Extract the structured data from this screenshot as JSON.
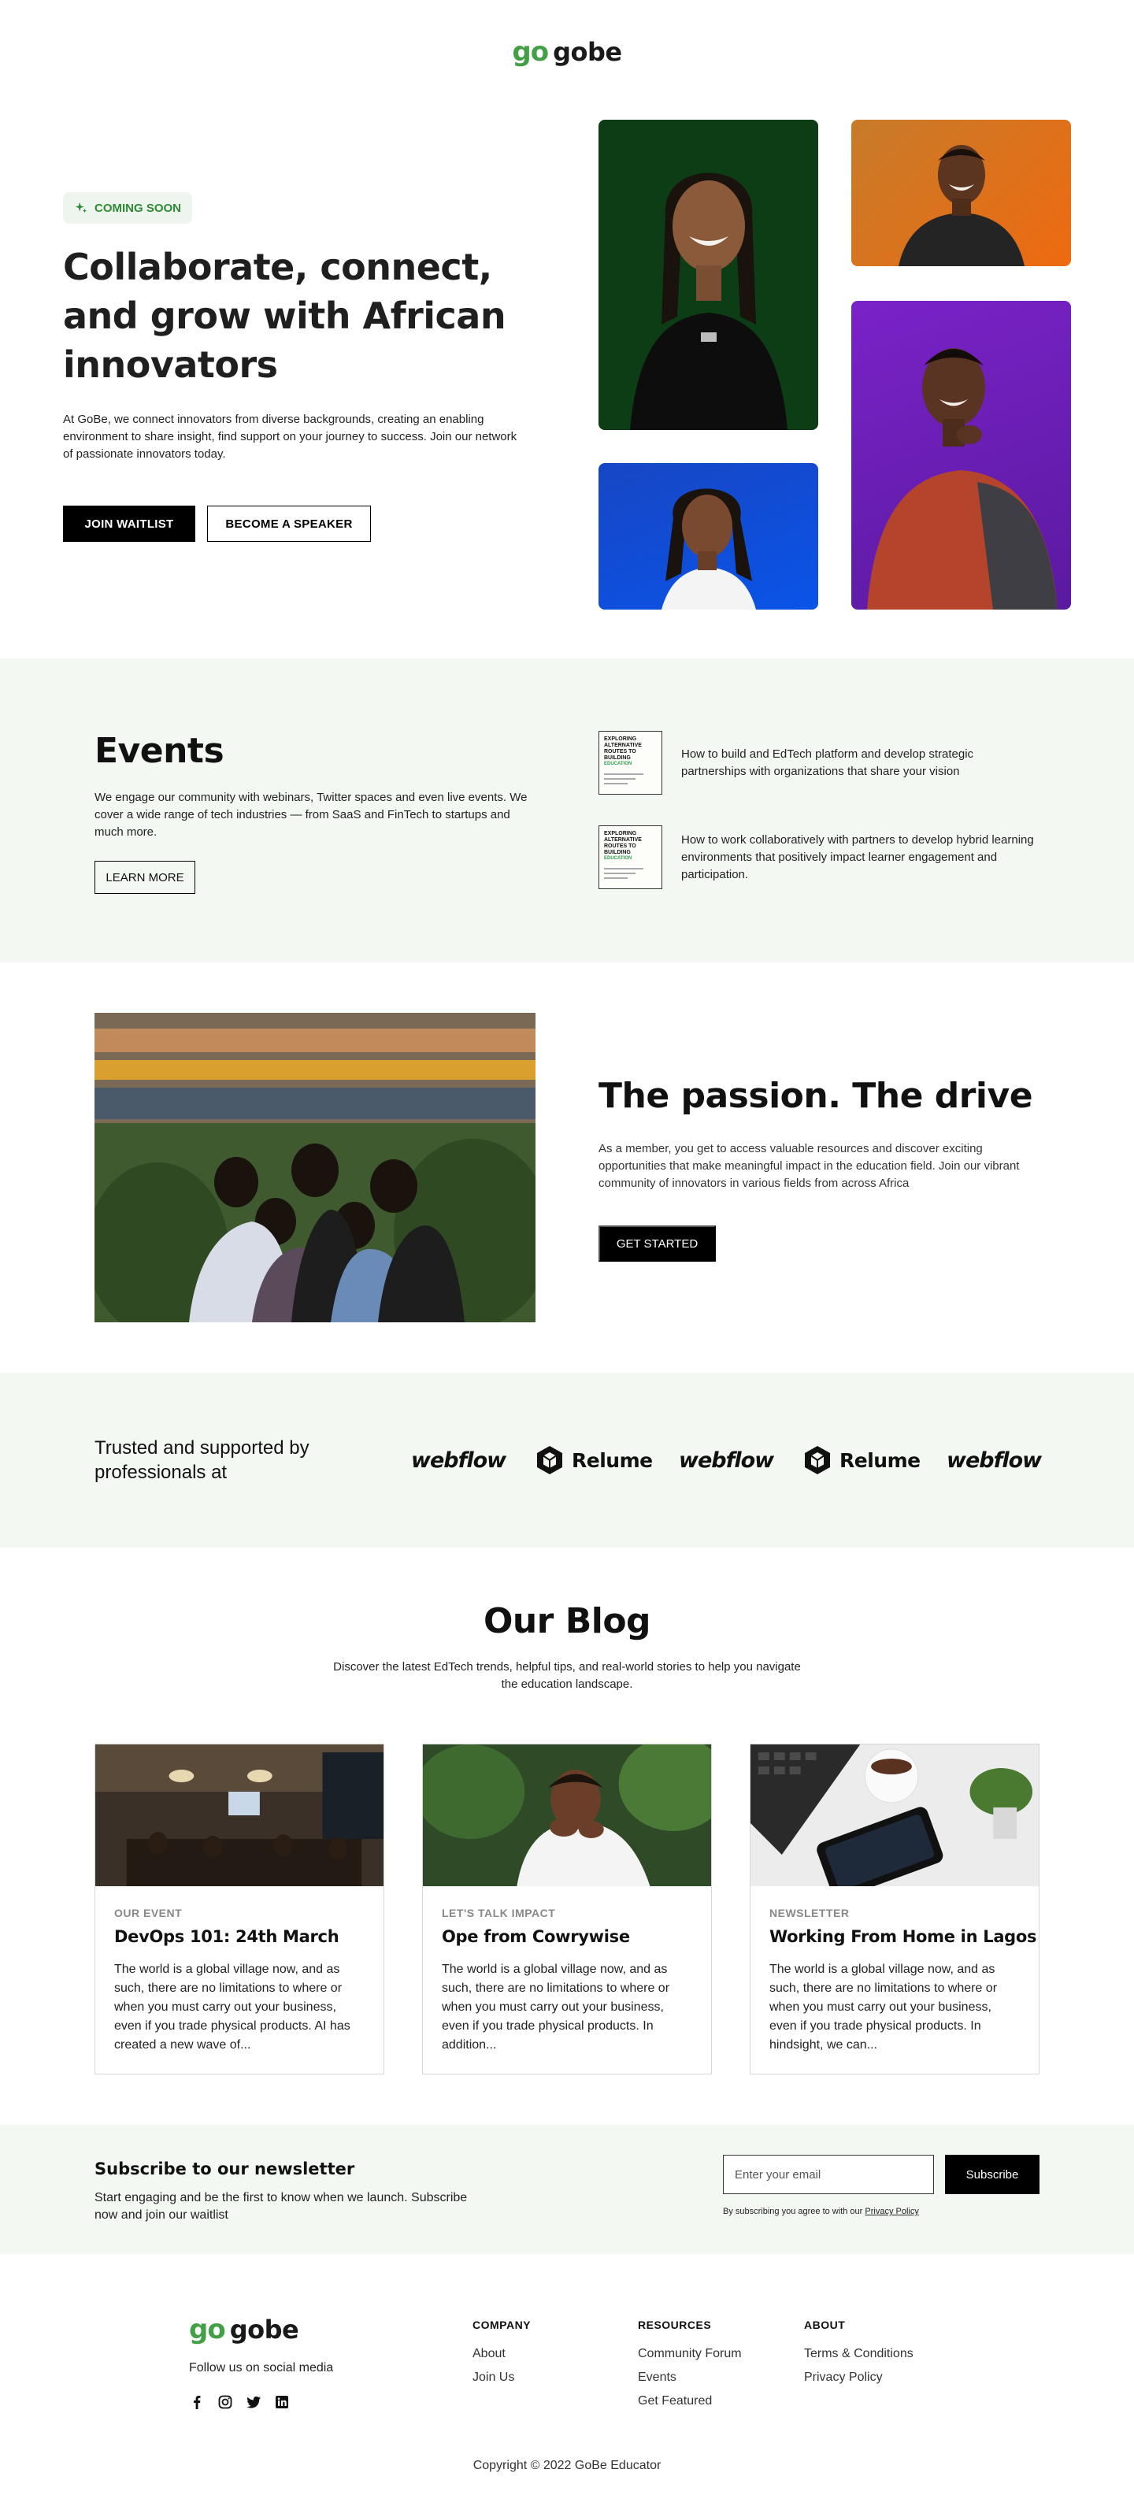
{
  "brand": {
    "mark": "go",
    "name": "gobe",
    "green": "#43a047"
  },
  "hero": {
    "badge": "COMING SOON",
    "title": "Collaborate, connect, and grow with African innovators",
    "description": "At GoBe, we connect innovators from diverse backgrounds, creating an enabling environment to share insight, find support on your journey to success. Join our network of passionate innovators today.",
    "primary_button": "JOIN WAITLIST",
    "secondary_button": "BECOME A SPEAKER"
  },
  "events": {
    "title": "Events",
    "description": "We engage our community with webinars, Twitter spaces and even live events. We cover a wide range of tech industries — from SaaS and FinTech to startups and much more.",
    "button": "LEARN MORE",
    "items": [
      {
        "thumb_title": "EXPLORING ALTERNATIVE ROUTES TO BUILDING",
        "thumb_sub": "EDUCATION",
        "text": "How to build and EdTech platform and develop strategic partnerships with organizations that share your vision"
      },
      {
        "thumb_title": "EXPLORING ALTERNATIVE ROUTES TO BUILDING",
        "thumb_sub": "EDUCATION",
        "text": "How to work collaboratively with partners to develop hybrid learning environments that positively impact learner engagement and participation."
      }
    ]
  },
  "passion": {
    "title": "The passion. The drive",
    "description": "As a member, you get to access valuable resources and discover exciting opportunities that make meaningful impact in the education field. Join our vibrant community of innovators in various fields from across Africa",
    "button": "GET STARTED"
  },
  "trusted": {
    "text": "Trusted and supported by professionals at",
    "logos": [
      "webflow",
      "Relume",
      "webflow",
      "Relume",
      "webflow"
    ]
  },
  "blog": {
    "title": "Our Blog",
    "description": "Discover the latest EdTech trends, helpful tips, and real-world stories to help you navigate the education landscape.",
    "cards": [
      {
        "category": "OUR EVENT",
        "title": "DevOps 101: 24th March",
        "text": "The world is a global village now, and as such, there are no limitations to where or when you must carry out your business, even if you trade physical products. AI has created a new wave of..."
      },
      {
        "category": "LET'S TALK IMPACT",
        "title": "Ope from Cowrywise",
        "text": "The world is a global village now, and as such, there are no limitations to where or when you must carry out your business, even if you trade physical products. In addition..."
      },
      {
        "category": "NEWSLETTER",
        "title": "Working From Home in Lagos",
        "text": "The world is a global village now, and as such, there are no limitations to where or when you must carry out your business, even if you trade physical products. In hindsight, we can..."
      }
    ]
  },
  "newsletter": {
    "title": "Subscribe to our newsletter",
    "description": "Start engaging and be the first to know when we launch. Subscribe now and join our waitlist",
    "placeholder": "Enter your email",
    "button": "Subscribe",
    "note": "By subscribing you agree to with our",
    "note_link": "Privacy Policy"
  },
  "footer": {
    "follow": "Follow us on social media",
    "social_icons": [
      "facebook-icon",
      "instagram-icon",
      "twitter-icon",
      "linkedin-icon"
    ],
    "columns": [
      {
        "title": "COMPANY",
        "links": [
          "About",
          "Join Us"
        ]
      },
      {
        "title": "RESOURCES",
        "links": [
          "Community Forum",
          "Events",
          "Get Featured"
        ]
      },
      {
        "title": "ABOUT",
        "links": [
          "Terms & Conditions",
          "Privacy Policy"
        ]
      }
    ],
    "copyright": "Copyright © 2022 GoBe Educator"
  }
}
